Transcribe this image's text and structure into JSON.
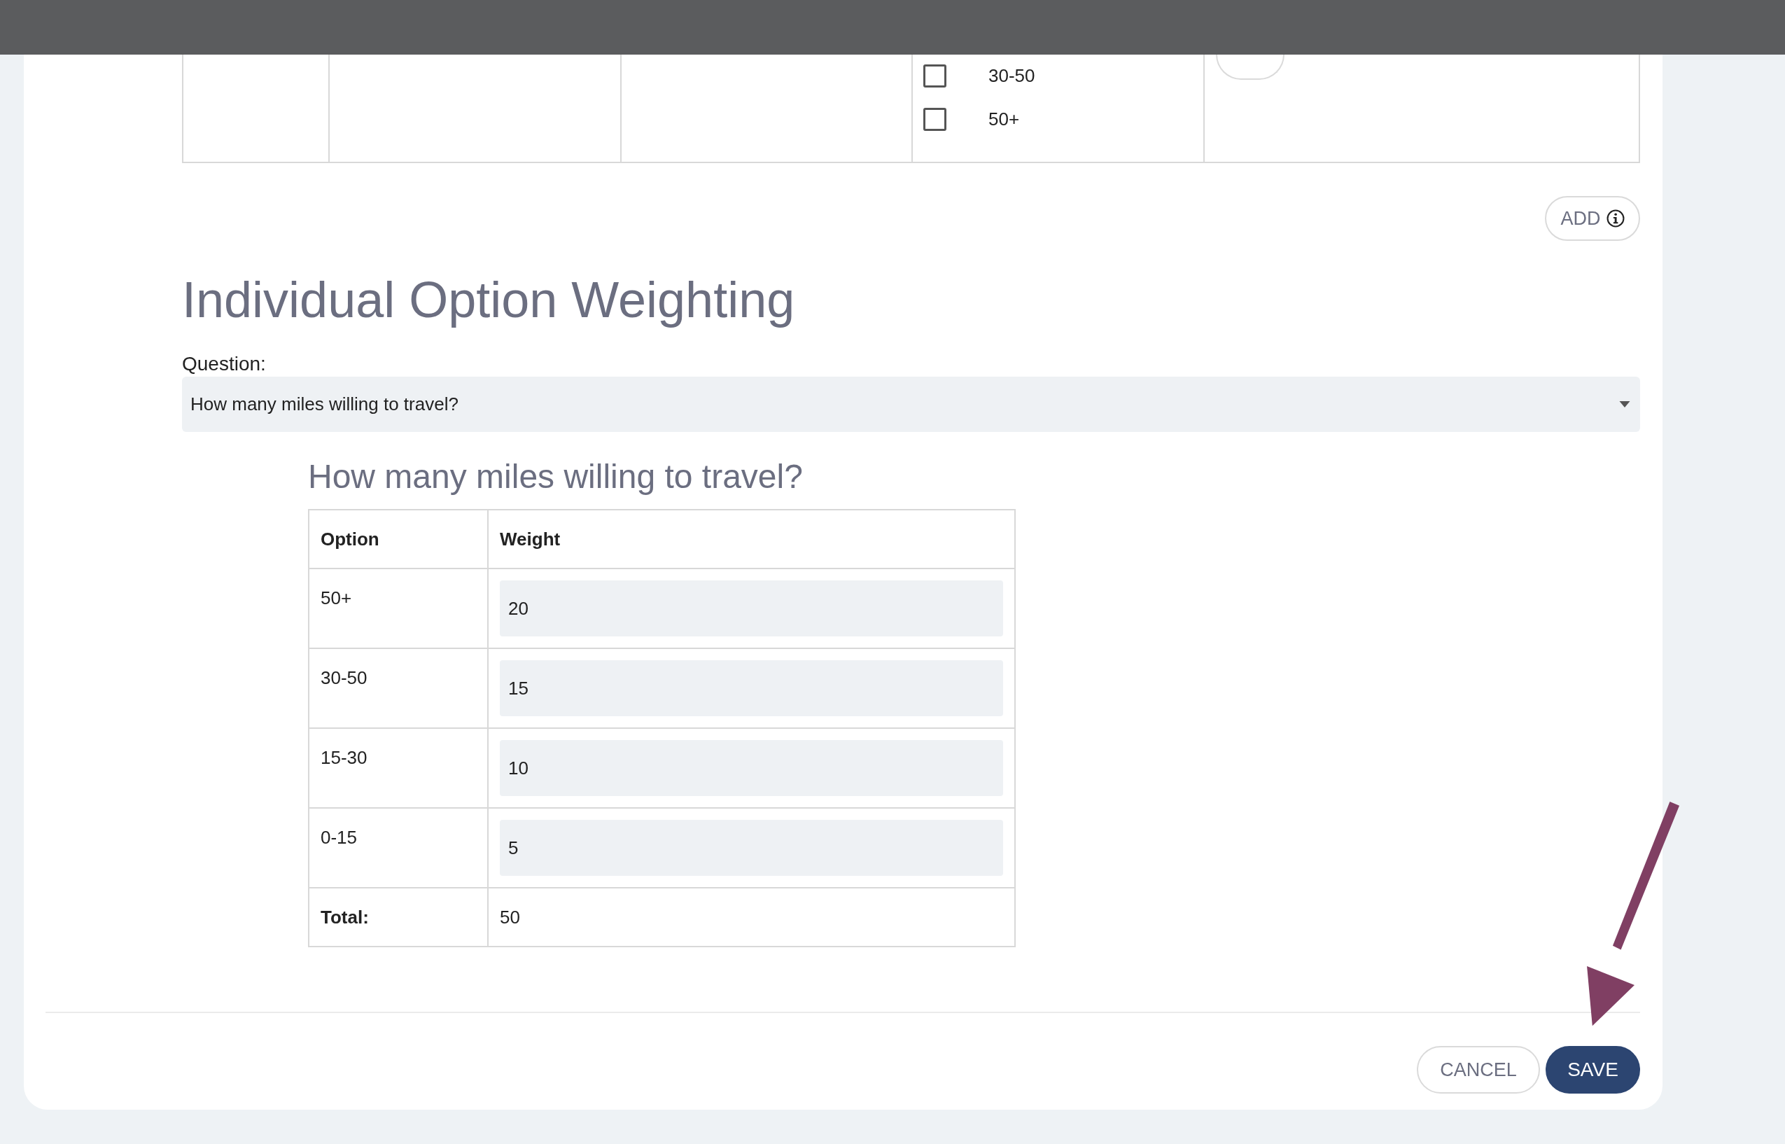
{
  "upper_table": {
    "options": [
      {
        "label": "30-50",
        "checked": false
      },
      {
        "label": "50+",
        "checked": false
      }
    ]
  },
  "add_button": "ADD",
  "section_title": "Individual Option Weighting",
  "question": {
    "label": "Question:",
    "value": "How many miles willing to travel?"
  },
  "weighting": {
    "title": "How many miles willing to travel?",
    "columns": [
      "Option",
      "Weight"
    ],
    "rows": [
      {
        "option": "50+",
        "weight": "20"
      },
      {
        "option": "30-50",
        "weight": "15"
      },
      {
        "option": "15-30",
        "weight": "10"
      },
      {
        "option": "0-15",
        "weight": "5"
      }
    ],
    "total_label": "Total:",
    "total": "50"
  },
  "buttons": [
    {
      "label": "CANCEL",
      "kind": "secondary"
    },
    {
      "label": "SAVE",
      "kind": "primary"
    }
  ]
}
